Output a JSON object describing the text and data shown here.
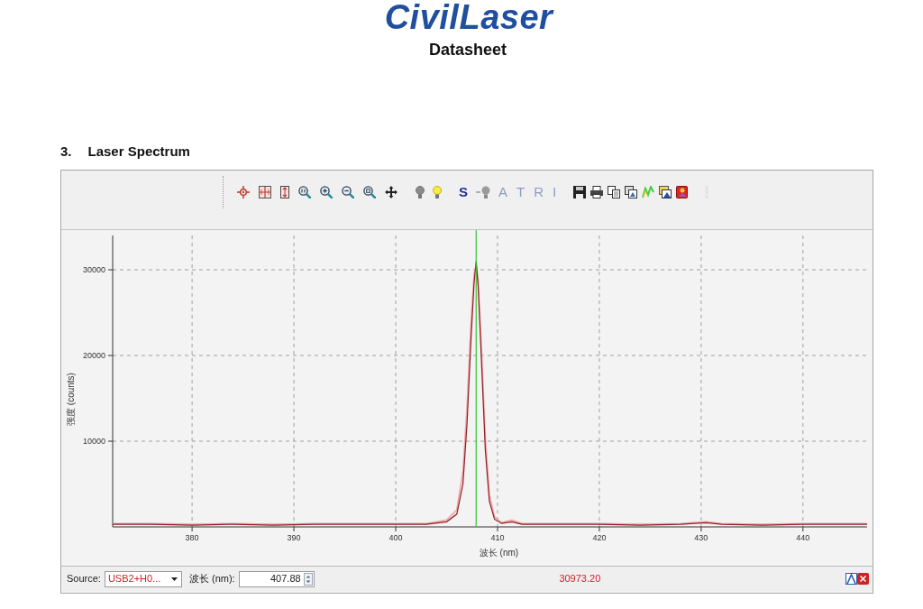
{
  "header": {
    "logo": "CivilLaser",
    "subtitle": "Datasheet"
  },
  "section": {
    "number": "3.",
    "title": "Laser Spectrum"
  },
  "spectrum_window": {
    "toolbar": {
      "letter_buttons": [
        {
          "label": "S",
          "disabled": false
        },
        {
          "label": "A",
          "disabled": true
        },
        {
          "label": "T",
          "disabled": true
        },
        {
          "label": "R",
          "disabled": true
        },
        {
          "label": "I",
          "disabled": true
        }
      ]
    },
    "chart_data": {
      "type": "line",
      "xlabel": "波长 (nm)",
      "ylabel": "强度 (counts)",
      "x": [
        372.2,
        376,
        380,
        384,
        388,
        392,
        396,
        400,
        403,
        405,
        406,
        406.6,
        407,
        407.4,
        407.7,
        407.9,
        408.1,
        408.4,
        408.8,
        409.2,
        409.7,
        410.4,
        411.4,
        412.4,
        416,
        420,
        424,
        428,
        430.5,
        432,
        436,
        440,
        443,
        446.3
      ],
      "series": [
        {
          "color": "#f2a5a5",
          "values": [
            400,
            400,
            300,
            400,
            300,
            400,
            400,
            400,
            400,
            800,
            2000,
            6500,
            14000,
            24000,
            29500,
            30500,
            28800,
            21500,
            10500,
            3800,
            1200,
            500,
            800,
            400,
            400,
            400,
            300,
            400,
            600,
            400,
            300,
            400,
            400,
            400
          ]
        },
        {
          "color": "#8e1f24",
          "values": [
            300,
            300,
            200,
            300,
            200,
            300,
            300,
            300,
            300,
            600,
            1500,
            5000,
            12000,
            22000,
            28500,
            31000,
            28000,
            20000,
            9000,
            3000,
            900,
            400,
            600,
            300,
            300,
            300,
            200,
            300,
            500,
            300,
            200,
            300,
            300,
            300
          ]
        }
      ],
      "xlim": [
        372.2,
        446.3
      ],
      "ylim": [
        0,
        34000
      ],
      "xticks": [
        380,
        390,
        400,
        410,
        420,
        430,
        440
      ],
      "yticks": [
        10000,
        20000,
        30000
      ],
      "grid": true,
      "ref_lines": [
        {
          "axis": "x",
          "value": 407.9,
          "color": "#35c435"
        }
      ]
    },
    "status_bar": {
      "source_label": "Source:",
      "source_value": "USB2+H0...",
      "wavelength_label": "波长 (nm):",
      "wavelength_value": "407.88",
      "intensity_reading": "30973.20"
    }
  }
}
